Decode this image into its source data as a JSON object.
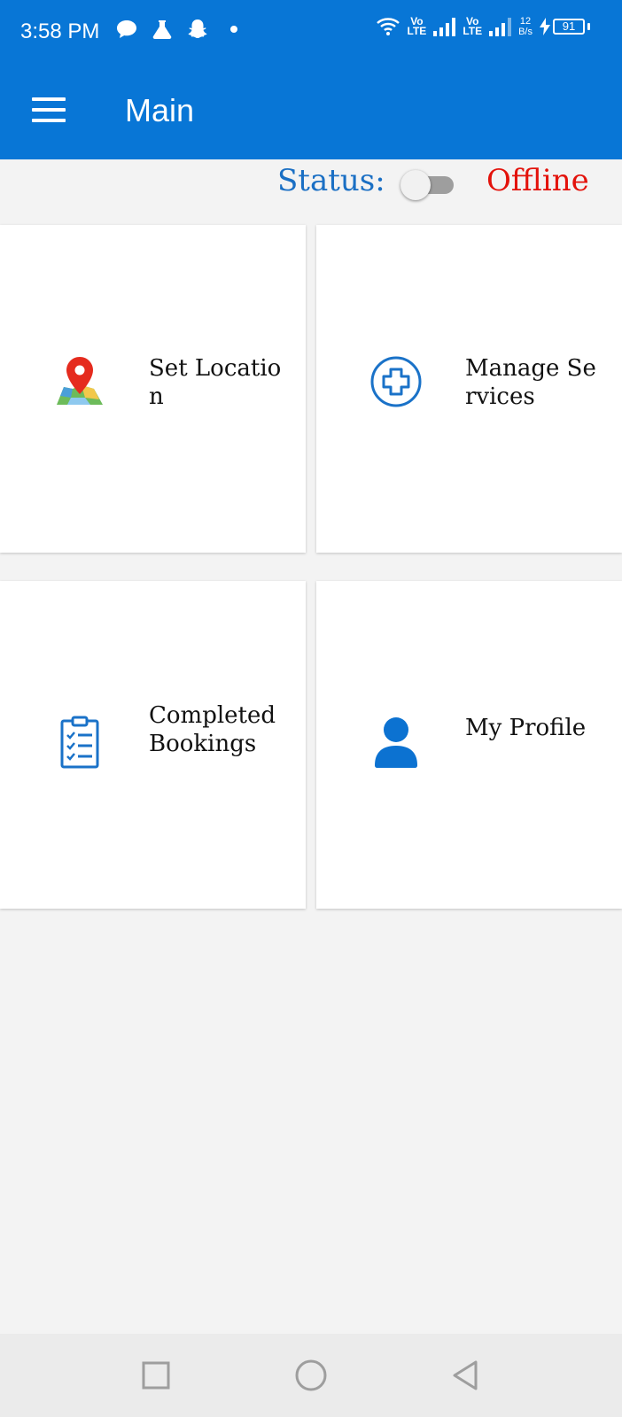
{
  "status_bar": {
    "time": "3:58 PM",
    "icons": [
      "chat-icon",
      "flask-icon",
      "snapchat-icon",
      "dot-icon",
      "wifi-icon",
      "signal-icon",
      "charging-icon"
    ],
    "sim1": {
      "top": "Vo",
      "bottom": "LTE"
    },
    "sim2": {
      "top": "Vo",
      "bottom": "LTE"
    },
    "speed_value": "12",
    "speed_unit": "B/s",
    "battery": "91"
  },
  "app_bar": {
    "title": "Main",
    "menu_icon": "hamburger-menu-icon"
  },
  "status": {
    "label": "Status:",
    "value": "Offline",
    "online": false,
    "label_color": "#1a6fc4",
    "value_color": "#e3120b"
  },
  "tiles": [
    {
      "label": "Set Location",
      "icon": "map-pin-icon"
    },
    {
      "label": "Manage Services",
      "icon": "plus-circle-icon"
    },
    {
      "label": "Completed Bookings",
      "icon": "clipboard-checklist-icon"
    },
    {
      "label": "My Profile",
      "icon": "user-icon"
    }
  ],
  "nav": {
    "buttons": [
      "square-recents-icon",
      "circle-home-icon",
      "triangle-back-icon"
    ]
  },
  "colors": {
    "primary": "#0876d6",
    "background": "#f3f3f3"
  }
}
